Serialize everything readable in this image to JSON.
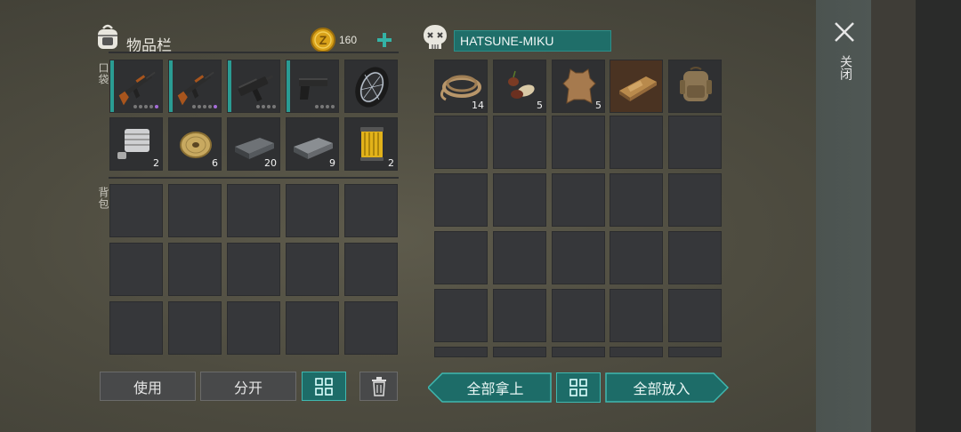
{
  "left_panel": {
    "title": "物品栏",
    "coins": "160",
    "pocket_label": "口袋",
    "backpack_label": "背包",
    "pocket_items": [
      {
        "icon": "ak47-rifle-icon",
        "count": ""
      },
      {
        "icon": "ak47-rifle-icon",
        "count": ""
      },
      {
        "icon": "uzi-smg-icon",
        "count": ""
      },
      {
        "icon": "pistol-icon",
        "count": ""
      },
      {
        "icon": "wheel-icon",
        "count": ""
      },
      {
        "icon": "engine-block-icon",
        "count": "2"
      },
      {
        "icon": "wire-spool-icon",
        "count": "6"
      },
      {
        "icon": "iron-ingot-icon",
        "count": "20"
      },
      {
        "icon": "steel-ingot-icon",
        "count": "9"
      },
      {
        "icon": "oil-filter-icon",
        "count": "2"
      }
    ],
    "buttons": {
      "use": "使用",
      "split": "分开"
    }
  },
  "right_panel": {
    "container_name": "HATSUNE-MIKU",
    "items": [
      {
        "icon": "rope-icon",
        "count": "14"
      },
      {
        "icon": "seeds-icon",
        "count": "5"
      },
      {
        "icon": "leather-hide-icon",
        "count": "5"
      },
      {
        "icon": "sled-icon",
        "count": ""
      },
      {
        "icon": "backpack-icon",
        "count": ""
      }
    ],
    "buttons": {
      "take_all": "全部拿上",
      "put_all": "全部放入"
    }
  },
  "close_label": "关闭",
  "colors": {
    "accent": "#1d6c68",
    "accent_border": "#3fb8b0",
    "purple_rarity": "#a56cd8",
    "coin": "#d9a21a"
  }
}
